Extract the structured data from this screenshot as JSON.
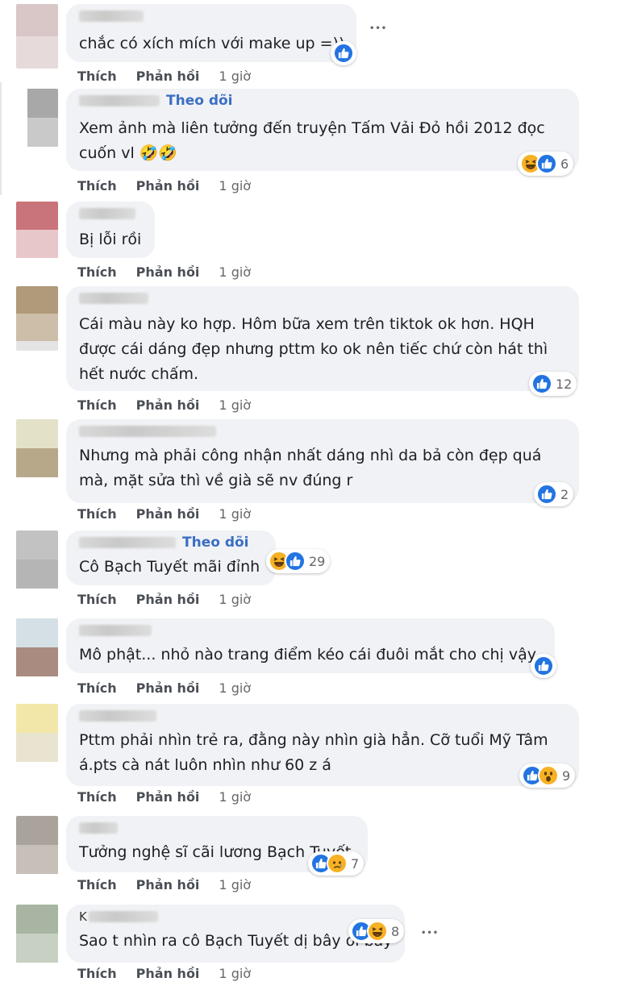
{
  "actions": {
    "like": "Thích",
    "reply": "Phản hồi"
  },
  "follow_label": "Theo dõi",
  "comments": [
    {
      "text": "chắc có xích mích với make up =))",
      "time": "1 giờ",
      "reactions": [
        "like"
      ],
      "count": ""
    },
    {
      "text": "Xem ảnh mà liên tưởng đến truyện Tấm Vải Đỏ hồi 2012 đọc\ncuốn vl 🤣🤣",
      "time": "1 giờ",
      "reactions": [
        "haha",
        "like"
      ],
      "count": "6"
    },
    {
      "text": "Bị lỗi rồi",
      "time": "1 giờ",
      "reactions": [],
      "count": ""
    },
    {
      "text": "Cái màu này ko hợp. Hôm bữa xem trên tiktok ok hơn. HQH\nđược cái dáng đẹp nhưng pttm ko ok nên tiếc chứ còn hát thì\nhết nước chấm.",
      "time": "1 giờ",
      "reactions": [
        "like"
      ],
      "count": "12"
    },
    {
      "text": "Nhưng mà phải công nhận nhất dáng nhì da bả còn đẹp quá\nmà, mặt sửa thì về già sẽ nv đúng r",
      "time": "1 giờ",
      "reactions": [
        "like"
      ],
      "count": "2"
    },
    {
      "text": "Cô Bạch Tuyết mãi đỉnh",
      "time": "1 giờ",
      "reactions": [
        "haha",
        "like"
      ],
      "count": "29"
    },
    {
      "text": "Mô phật... nhỏ nào trang điểm kéo cái đuôi mắt cho chị vậy",
      "time": "1 giờ",
      "reactions": [
        "like"
      ],
      "count": ""
    },
    {
      "text": "Pttm phải nhìn trẻ ra, đằng này nhìn già hẳn. Cỡ tuổi Mỹ Tâm\ná.pts cà nát luôn nhìn như 60 z á",
      "time": "1 giờ",
      "reactions": [
        "like",
        "wow"
      ],
      "count": "9"
    },
    {
      "text": "Tưởng nghệ sĩ cãi lương Bạch Tuyết",
      "time": "1 giờ",
      "reactions": [
        "like",
        "sad"
      ],
      "count": "7"
    },
    {
      "text": "Sao t nhìn ra cô Bạch Tuyết dị bây ơi bây",
      "time": "1 giờ",
      "reactions": [
        "like",
        "haha"
      ],
      "count": "8"
    }
  ],
  "visible_name_fragments": {
    "c10": "K"
  },
  "colors": {
    "like": "#2374e1",
    "follow": "#3b6fc2",
    "bubble": "#f0f2f5"
  }
}
